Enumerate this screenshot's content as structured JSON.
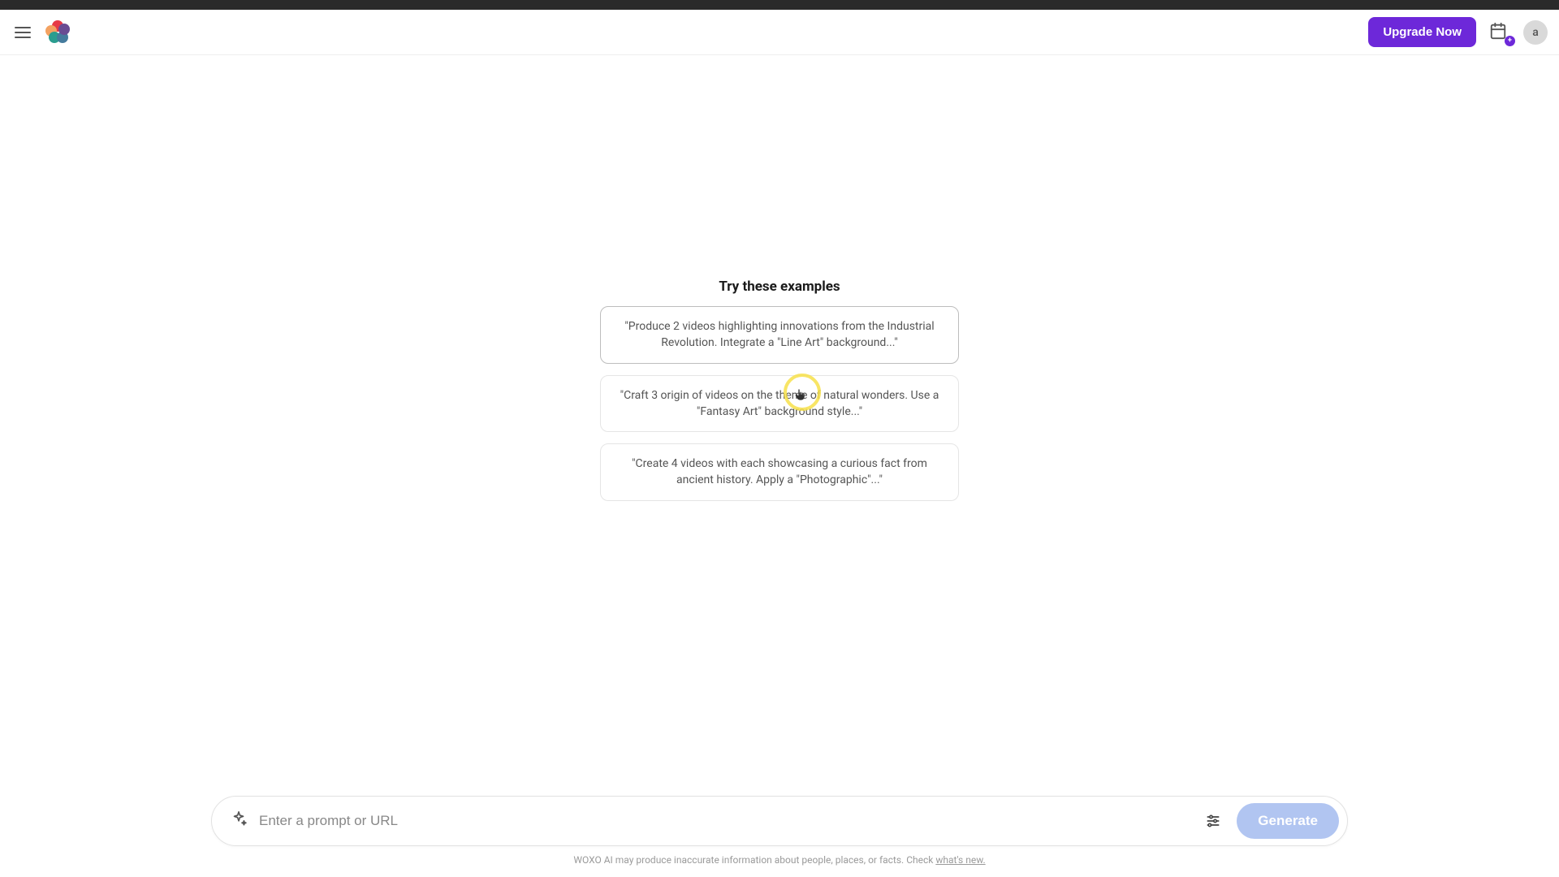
{
  "header": {
    "upgrade_label": "Upgrade Now",
    "calendar_badge": "+",
    "avatar_initial": "a"
  },
  "examples": {
    "title": "Try these examples",
    "items": [
      "\"Produce 2 videos highlighting innovations from the Industrial Revolution. Integrate a \"Line Art\" background...\"",
      "\"Craft 3 origin of videos on the theme of natural wonders. Use a \"Fantasy Art\" background style...\"",
      "\"Create 4 videos with each showcasing a curious fact from ancient history. Apply a \"Photographic\"...\""
    ]
  },
  "prompt": {
    "placeholder": "Enter a prompt or URL",
    "generate_label": "Generate"
  },
  "disclaimer": {
    "text_prefix": "WOXO AI may produce inaccurate information about people, places, or facts. Check ",
    "link_label": "what's new."
  }
}
